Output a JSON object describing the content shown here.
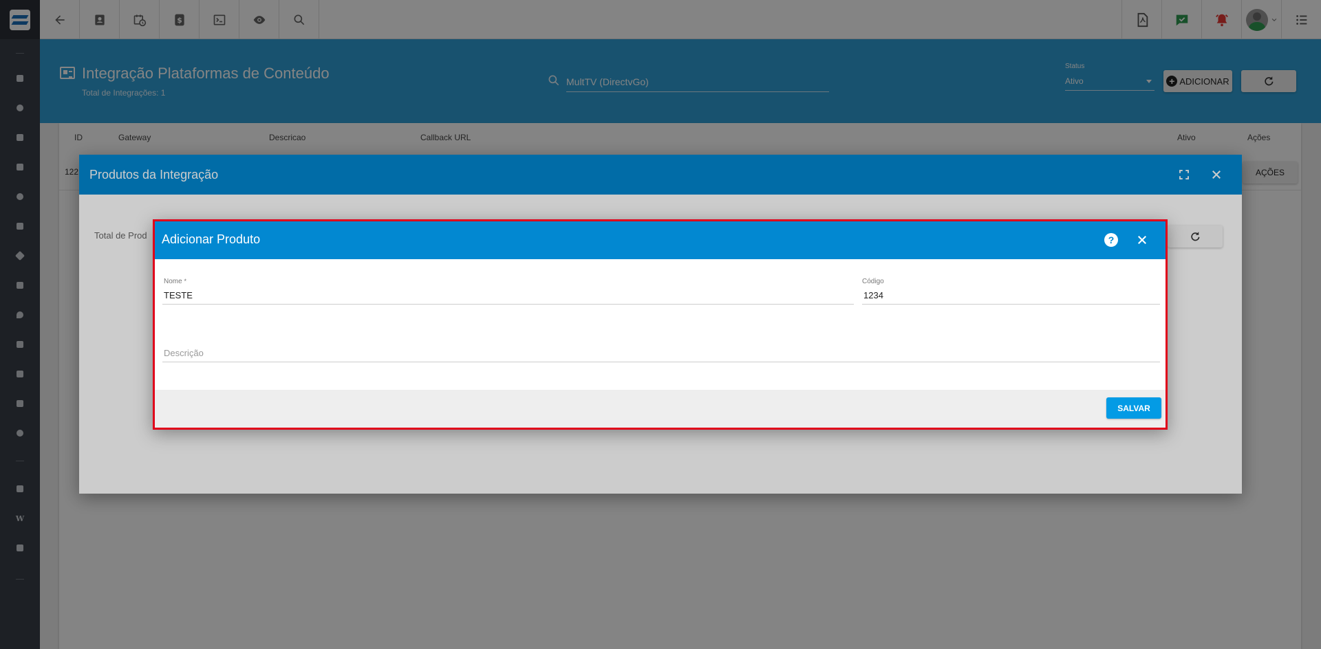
{
  "topbar": {
    "left_icons": [
      "back-arrow-icon",
      "contact-card-icon",
      "calendar-clock-icon",
      "dollar-icon",
      "terminal-icon",
      "eye-icon",
      "search-icon"
    ],
    "right_icons": [
      "pdf-icon",
      "chat-check-icon",
      "alarm-bell-icon",
      "avatar",
      "list-menu-icon"
    ]
  },
  "sidebar": {
    "icons": [
      "dashboard-icon",
      "chart-icon",
      "contacts-icon",
      "kanban-icon",
      "calendar-icon",
      "briefcase-icon",
      "box-icon",
      "book-icon",
      "map-pin-icon",
      "document-icon",
      "server-icon",
      "file-icon",
      "settings-icon",
      "video-icon",
      "wiki-icon",
      "chat-icon"
    ],
    "wiki_letter": "W"
  },
  "page": {
    "title": "Integração Plataformas de Conteúdo",
    "subtitle": "Total de Integrações: 1",
    "search_value": "MultTV (DirectvGo)",
    "status_label": "Status",
    "status_value": "Ativo",
    "add_label": "ADICIONAR"
  },
  "table": {
    "headers": [
      "ID",
      "Gateway",
      "Descricao",
      "Callback URL",
      "Ativo",
      "Ações"
    ],
    "row_id": "122",
    "acoes_label": "AÇÕES"
  },
  "modal1": {
    "title": "Produtos da Integração",
    "total_label": "Total de Prod"
  },
  "modal2": {
    "title": "Adicionar Produto",
    "help_label": "?",
    "nome_label": "Nome",
    "nome_required": "*",
    "nome_value": "TESTE",
    "codigo_label": "Código",
    "codigo_value": "1234",
    "descricao_placeholder": "Descrição",
    "salvar_label": "SALVAR"
  },
  "colors": {
    "primary": "#0288d1",
    "header_band": "#2f9fd6",
    "highlight_border": "#e0001a",
    "save_button": "#039be5",
    "alarm": "#e53935",
    "chat_green": "#2e9b52"
  }
}
